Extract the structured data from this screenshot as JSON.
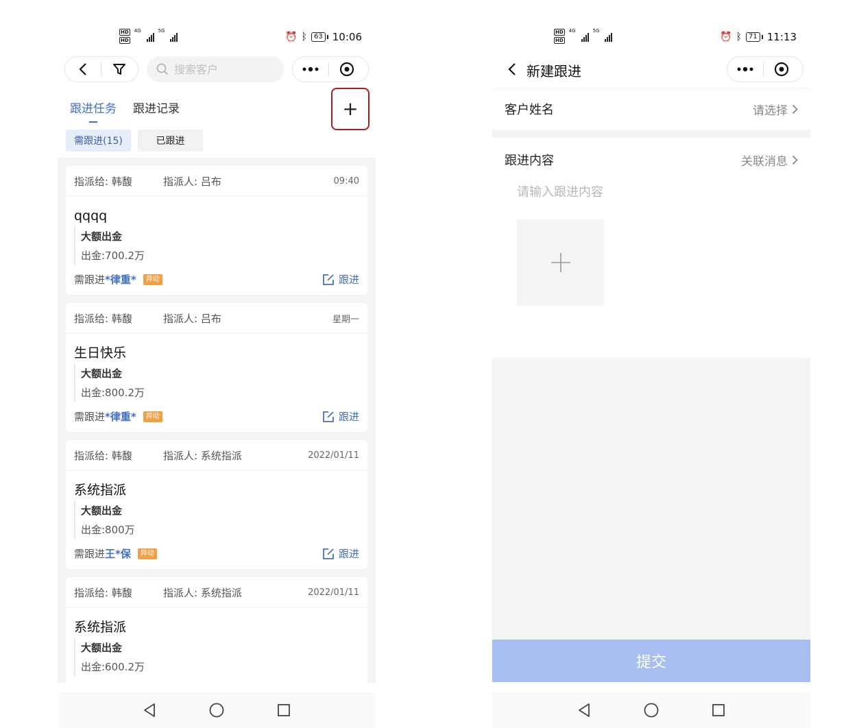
{
  "left": {
    "status": {
      "time": "10:06",
      "battery": "63",
      "net1": "4G",
      "net2": "5G"
    },
    "search": {
      "placeholder": "搜索客户"
    },
    "tabs": [
      {
        "label": "跟进任务"
      },
      {
        "label": "跟进记录"
      }
    ],
    "add_label": "+",
    "chips": [
      {
        "label": "需跟进(15)"
      },
      {
        "label": "已跟进"
      }
    ],
    "cards": [
      {
        "assignee": "指派给: 韩馥",
        "assigner": "指派人: 吕布",
        "time": "09:40",
        "title": "qqqq",
        "category": "大额出金",
        "amount": "出金:700.2万",
        "need_prefix": "需跟进",
        "customer": "*律重*",
        "badge": "异动",
        "action": "跟进"
      },
      {
        "assignee": "指派给: 韩馥",
        "assigner": "指派人: 吕布",
        "time": "星期一",
        "title": "生日快乐",
        "category": "大额出金",
        "amount": "出金:800.2万",
        "need_prefix": "需跟进",
        "customer": "*律重*",
        "badge": "异动",
        "action": "跟进"
      },
      {
        "assignee": "指派给: 韩馥",
        "assigner": "指派人: 系统指派",
        "time": "2022/01/11",
        "title": "系统指派",
        "category": "大额出金",
        "amount": "出金:800万",
        "need_prefix": "需跟进",
        "customer": "王*保",
        "badge": "异动",
        "action": "跟进"
      },
      {
        "assignee": "指派给: 韩馥",
        "assigner": "指派人: 系统指派",
        "time": "2022/01/11",
        "title": "系统指派",
        "category": "大额出金",
        "amount": "出金:600.2万",
        "need_prefix": "",
        "customer": "",
        "badge": "",
        "action": ""
      }
    ]
  },
  "right": {
    "status": {
      "time": "11:13",
      "battery": "71",
      "net1": "4G",
      "net2": "5G"
    },
    "title": "新建跟进",
    "customer_row": {
      "label": "客户姓名",
      "value": "请选择"
    },
    "content_row": {
      "label": "跟进内容",
      "value": "关联消息"
    },
    "content_placeholder": "请输入跟进内容",
    "submit_label": "提交"
  },
  "colors": {
    "accent": "#4370c3",
    "badge": "#f0a045",
    "highlight": "#b01a1a",
    "submit": "#a7bff0"
  }
}
